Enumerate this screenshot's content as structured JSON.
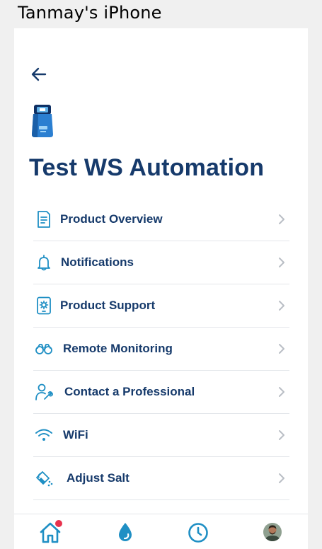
{
  "device": {
    "name": "Tanmay's iPhone"
  },
  "header": {
    "title": "Test WS Automation"
  },
  "menu": [
    {
      "label": "Product Overview",
      "icon": "document-icon"
    },
    {
      "label": "Notifications",
      "icon": "bell-icon"
    },
    {
      "label": "Product Support",
      "icon": "tablet-gear-icon"
    },
    {
      "label": "Remote Monitoring",
      "icon": "binoculars-icon"
    },
    {
      "label": "Contact a Professional",
      "icon": "person-wrench-icon"
    },
    {
      "label": "WiFi",
      "icon": "wifi-icon"
    },
    {
      "label": "Adjust Salt",
      "icon": "salt-bucket-icon"
    }
  ],
  "bottom_nav": [
    {
      "name": "home",
      "icon": "home-icon",
      "has_badge": true
    },
    {
      "name": "water",
      "icon": "water-drop-icon"
    },
    {
      "name": "history",
      "icon": "clock-icon"
    },
    {
      "name": "profile",
      "icon": "avatar"
    }
  ],
  "colors": {
    "title": "#163a6b",
    "icon": "#1f8fc4",
    "chevron": "#b9bec5",
    "divider": "#e3e6ea",
    "badge": "#e8324d",
    "background": "#f0f0f0"
  }
}
